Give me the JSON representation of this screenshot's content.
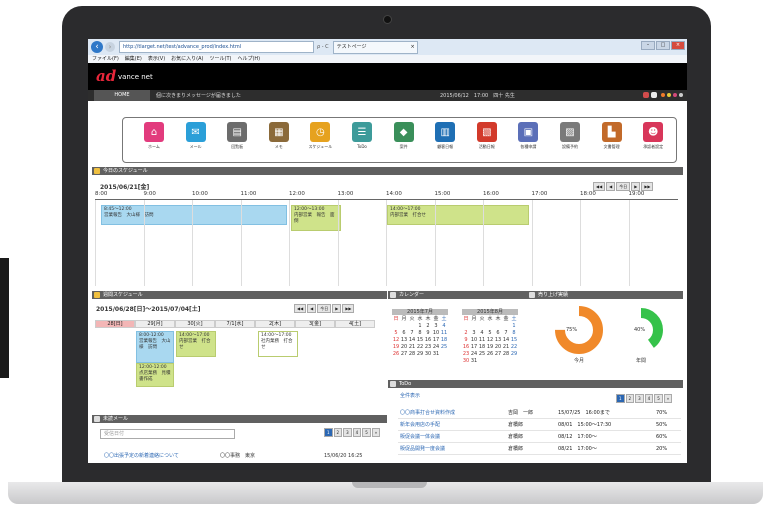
{
  "browser": {
    "url": "http://tlarget.net/test/advance_prod/index.html",
    "search_tools": "ρ - C",
    "tab_title": "テストページ",
    "tab_close": "×",
    "window_controls": [
      "–",
      "□",
      "×"
    ],
    "menu": [
      "ファイル(F)",
      "編集(E)",
      "表示(V)",
      "お気に入り(A)",
      "ツール(T)",
      "ヘルプ(H)"
    ]
  },
  "app": {
    "logo_main": "ad",
    "logo_sub": "vance net",
    "home_label": "HOME",
    "message": "個に次きまりメッセージが届きました",
    "status_date": "2015/06/12　17:00　四十 先生",
    "apps": [
      {
        "label": "ホーム",
        "icon": "home-icon",
        "color": "#e23b7d"
      },
      {
        "label": "メール",
        "icon": "mail-icon",
        "color": "#2b9fd8"
      },
      {
        "label": "回覧板",
        "icon": "clipboard-icon",
        "color": "#6c6c6c"
      },
      {
        "label": "メモ",
        "icon": "memo-icon",
        "color": "#8b6a3a"
      },
      {
        "label": "スケジュール",
        "icon": "schedule-icon",
        "color": "#e6a21f"
      },
      {
        "label": "ToDo",
        "icon": "todo-icon",
        "color": "#3d9b9a"
      },
      {
        "label": "案件",
        "icon": "handshake-icon",
        "color": "#3a8f5a"
      },
      {
        "label": "顧客日報",
        "icon": "report-icon",
        "color": "#1f6fb4"
      },
      {
        "label": "活動日報",
        "icon": "daily-report-icon",
        "color": "#d23a2b"
      },
      {
        "label": "各種申請",
        "icon": "application-icon",
        "color": "#5b6fb8"
      },
      {
        "label": "設備予約",
        "icon": "equipment-icon",
        "color": "#7a7a7a"
      },
      {
        "label": "文書管理",
        "icon": "document-icon",
        "color": "#c26a2a"
      },
      {
        "label": "承認者設定",
        "icon": "users-icon",
        "color": "#d8365a"
      }
    ]
  },
  "today": {
    "header": "今日のスケジュール",
    "date": "2015/06/21[金]",
    "pager": [
      "◀◀",
      "◀",
      "今日",
      "▶",
      "▶▶"
    ],
    "hours": [
      "8:00",
      "9:00",
      "10:00",
      "11:00",
      "12:00",
      "13:00",
      "14:00",
      "15:00",
      "16:00",
      "17:00",
      "18:00",
      "19:00"
    ],
    "events": [
      {
        "time": "8:45〜12:00",
        "title": "営業報告　大山様　訪問"
      },
      {
        "time": "12:00〜13:00",
        "title": "内部営業　報告　面倒"
      },
      {
        "time": "14:00〜17:00",
        "title": "内部営業　打合せ"
      }
    ]
  },
  "weekly": {
    "header": "週間スケジュール",
    "range": "2015/06/28[日]〜2015/07/04[土]",
    "pager": [
      "◀◀",
      "◀",
      "今日",
      "▶",
      "▶▶"
    ],
    "days": [
      "28[日]",
      "29[月]",
      "30[火]",
      "7/1[水]",
      "2[木]",
      "3[金]",
      "4[土]"
    ],
    "events": [
      {
        "time": "8:00-12:00",
        "title": "営業報告　大山様　訪問"
      },
      {
        "time": "14:00〜17:00",
        "title": "内部営業　打合せ"
      },
      {
        "time": "14:00〜17:00",
        "title": "社内業務　打合せ"
      },
      {
        "time": "12:00-12:00",
        "title": "点店業務　見積書作成"
      }
    ]
  },
  "calendar": {
    "header": "カレンダー",
    "months": [
      {
        "title": "2015年7月",
        "weekdays": [
          "日",
          "月",
          "火",
          "水",
          "木",
          "金",
          "土"
        ],
        "days": [
          "",
          "",
          "",
          "1",
          "2",
          "3",
          "4",
          "5",
          "6",
          "7",
          "8",
          "9",
          "10",
          "11",
          "12",
          "13",
          "14",
          "15",
          "16",
          "17",
          "18",
          "19",
          "20",
          "21",
          "22",
          "23",
          "24",
          "25",
          "26",
          "27",
          "28",
          "29",
          "30",
          "31",
          ""
        ]
      },
      {
        "title": "2015年8月",
        "weekdays": [
          "日",
          "月",
          "火",
          "水",
          "木",
          "金",
          "土"
        ],
        "days": [
          "",
          "",
          "",
          "",
          "",
          "",
          "1",
          "2",
          "3",
          "4",
          "5",
          "6",
          "7",
          "8",
          "9",
          "10",
          "11",
          "12",
          "13",
          "14",
          "15",
          "16",
          "17",
          "18",
          "19",
          "20",
          "21",
          "22",
          "23",
          "24",
          "25",
          "26",
          "27",
          "28",
          "29",
          "30",
          "31",
          "",
          "",
          "",
          "",
          ""
        ]
      }
    ]
  },
  "sales": {
    "header": "売り上げ実績",
    "gauges": [
      {
        "value_label": "75%",
        "value": 0.75,
        "caption": "今月",
        "color": "#f0892a"
      },
      {
        "value_label": "40%",
        "value": 0.4,
        "caption": "年間",
        "color": "#35c24a"
      }
    ]
  },
  "todo": {
    "header": "ToDo",
    "link": "全件表示",
    "pages": [
      "1",
      "2",
      "3",
      "4",
      "5",
      "»"
    ],
    "rows": [
      {
        "title": "〇〇商事打合せ資料作成",
        "who": "吉岡　一郎",
        "date": "15/07/25　16:00まで",
        "pct": "70%"
      },
      {
        "title": "新年会用店の手配",
        "who": "倉橋郎",
        "date": "08/01　15:00〜17:30",
        "pct": "50%"
      },
      {
        "title": "販促会議一体会議",
        "who": "倉橋郎",
        "date": "08/12　17:00〜",
        "pct": "60%"
      },
      {
        "title": "販促品開発一度会議",
        "who": "倉橋郎",
        "date": "08/21　17:00〜",
        "pct": "20%"
      }
    ]
  },
  "inbox": {
    "header": "未読メール",
    "placeholder": "受信日付",
    "pages": [
      "1",
      "2",
      "3",
      "4",
      "5",
      "»"
    ],
    "row": {
      "subject": "〇〇出張予定の新着連絡について",
      "from": "〇〇事務　東京",
      "date": "15/06/20 16:25"
    }
  }
}
